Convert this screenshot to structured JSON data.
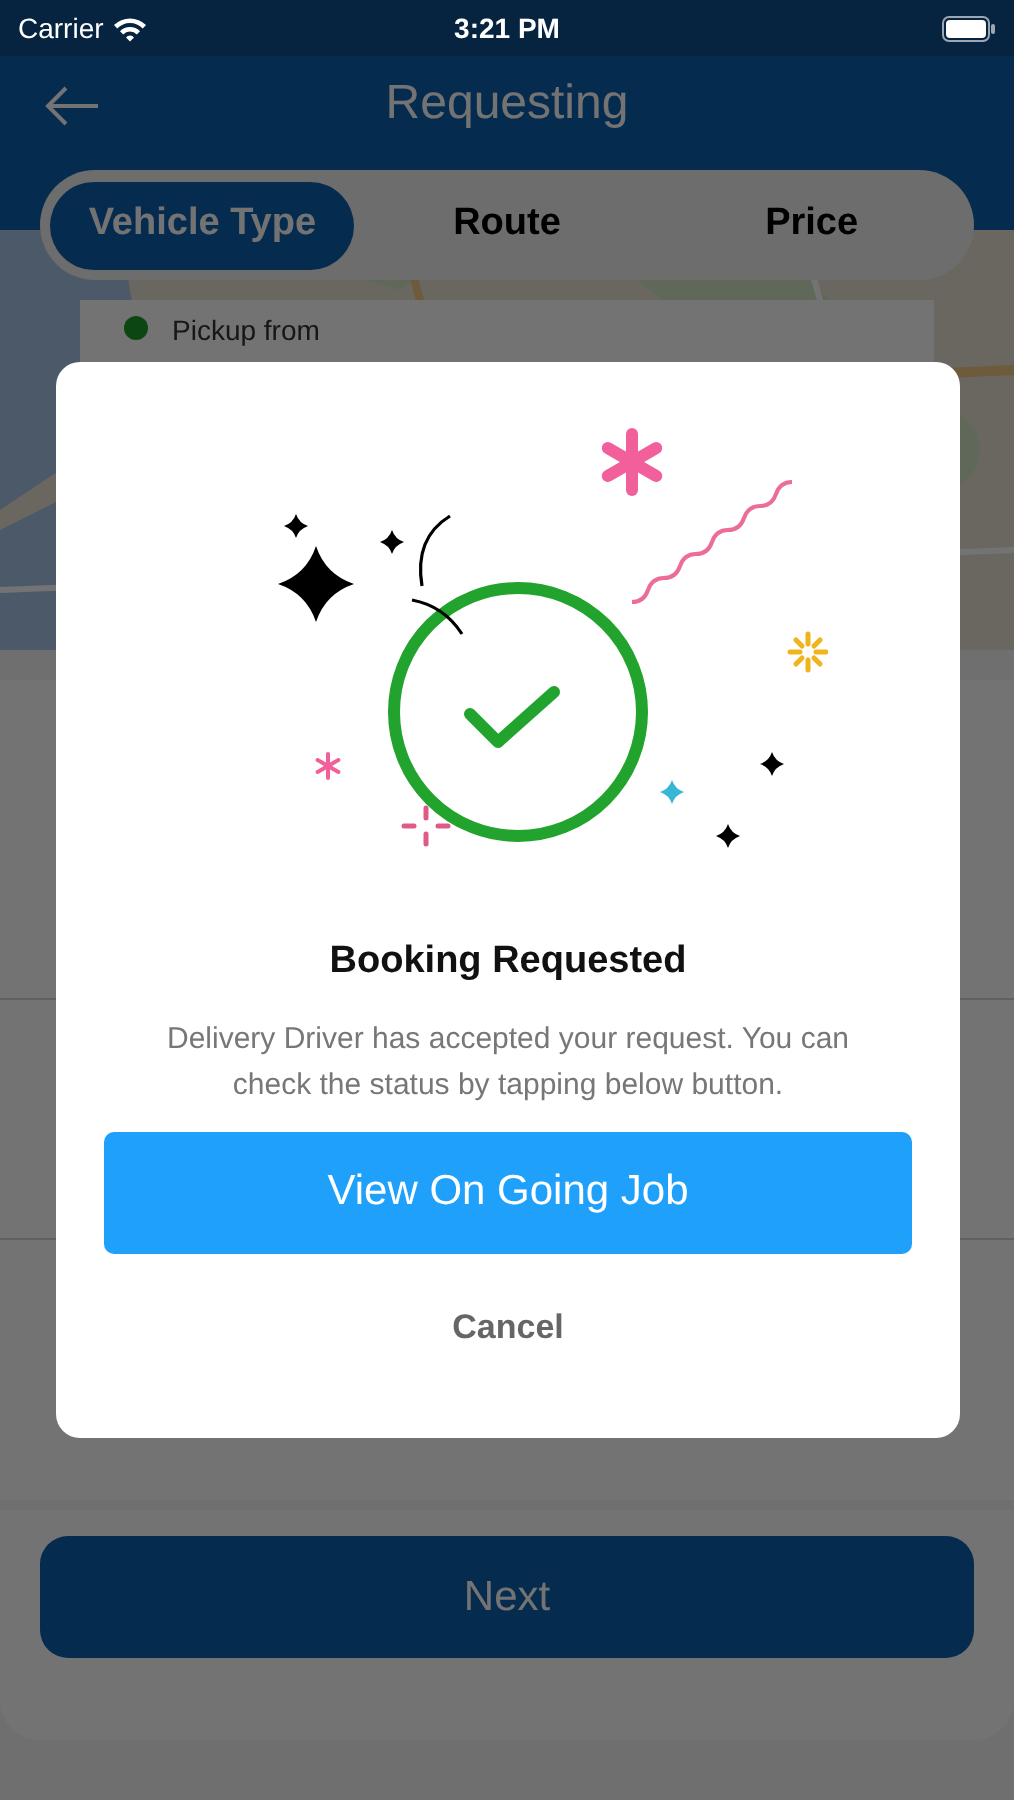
{
  "status_bar": {
    "carrier": "Carrier",
    "time": "3:21 PM"
  },
  "header": {
    "title": "Requesting"
  },
  "tabs": [
    {
      "label": "Vehicle Type",
      "selected": true
    },
    {
      "label": "Route",
      "selected": false
    },
    {
      "label": "Price",
      "selected": false
    }
  ],
  "pickup": {
    "label": "Pickup from"
  },
  "next_button": "Next",
  "dialog": {
    "title": "Booking Requested",
    "message": "Delivery Driver has accepted your request. You can check the status by tapping below button.",
    "primary_button": "View On Going Job",
    "cancel_button": "Cancel"
  }
}
